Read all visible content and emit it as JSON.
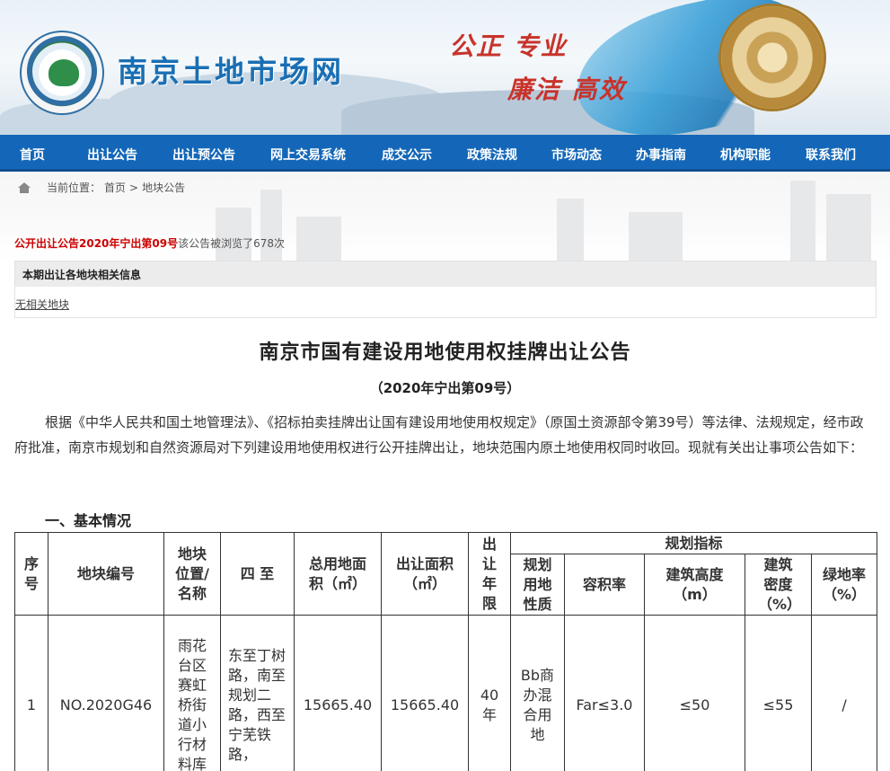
{
  "header": {
    "site_name": "南京土地市场网",
    "slogan_line1": "公正  专业",
    "slogan_line2": "廉洁  高效"
  },
  "nav": [
    {
      "label": "首页"
    },
    {
      "label": "出让公告"
    },
    {
      "label": "出让预公告"
    },
    {
      "label": "网上交易系统"
    },
    {
      "label": "成交公示"
    },
    {
      "label": "政策法规"
    },
    {
      "label": "市场动态"
    },
    {
      "label": "办事指南"
    },
    {
      "label": "机构职能"
    },
    {
      "label": "联系我们"
    }
  ],
  "breadcrumb": {
    "prefix": "当前位置：",
    "home": "首页",
    "separator": ">",
    "current": "地块公告"
  },
  "announcement": {
    "title": "公开出让公告2020年宁出第09号",
    "views_text": "该公告被浏览了678次"
  },
  "related": {
    "heading": "本期出让各地块相关信息",
    "link": "无相关地块"
  },
  "document": {
    "title": "南京市国有建设用地使用权挂牌出让公告",
    "subtitle": "（2020年宁出第09号）",
    "paragraph": "根据《中华人民共和国土地管理法》、《招标拍卖挂牌出让国有建设用地使用权规定》（原国土资源部令第39号）等法律、法规规定，经市政府批准，南京市规划和自然资源局对下列建设用地使用权进行公开挂牌出让，地块范围内原土地使用权同时收回。现就有关出让事项公告如下：",
    "section1": "一、基本情况"
  },
  "table": {
    "headers": {
      "seq": "序号",
      "plot_no": "地块编号",
      "location": "地块位置/名称",
      "boundary": "四 至",
      "total_area": "总用地面积（㎡）",
      "transfer_area": "出让面积（㎡）",
      "term": "出让年限",
      "planning": "规划指标",
      "land_use": "规划用地性质",
      "far": "容积率",
      "height": "建筑高度（m）",
      "density": "建筑密度（%）",
      "green": "绿地率（%）"
    },
    "rows": [
      {
        "seq": "1",
        "plot_no": "NO.2020G46",
        "location": "雨花台区赛虹桥街道小行材料库",
        "boundary": "东至丁树路，南至规划二路，西至宁芜铁路，",
        "total_area": "15665.40",
        "transfer_area": "15665.40",
        "term": "40年",
        "land_use": "Bb商办混合用地",
        "far": "Far≤3.0",
        "height": "≤50",
        "density": "≤55",
        "green": "/"
      }
    ]
  }
}
